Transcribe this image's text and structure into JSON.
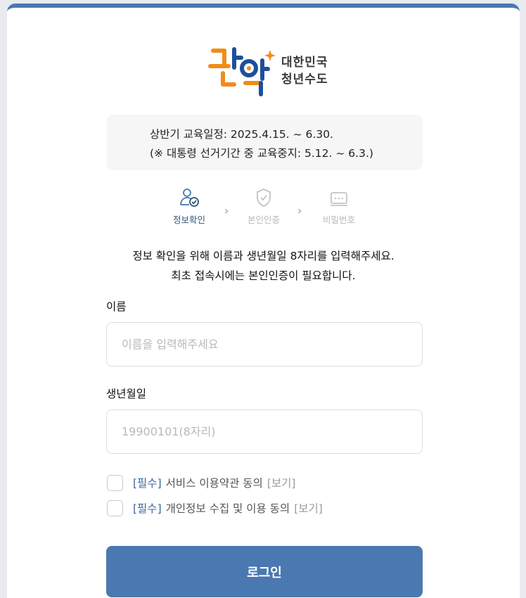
{
  "logo": {
    "tagline_line1": "대한민국",
    "tagline_line2": "청년수도"
  },
  "notice": {
    "line1": "상반기 교육일정: 2025.4.15. ~ 6.30.",
    "line2": "(※ 대통령 선거기간 중 교육중지: 5.12. ~ 6.3.)"
  },
  "steps": [
    {
      "label": "정보확인",
      "icon": "user-check-icon",
      "state": "active"
    },
    {
      "label": "본인인증",
      "icon": "shield-check-icon",
      "state": "inactive"
    },
    {
      "label": "비밀번호",
      "icon": "password-icon",
      "state": "inactive"
    }
  ],
  "instruction": {
    "line1": "정보 확인을 위해 이름과 생년월일 8자리를 입력해주세요.",
    "line2": "최초 접속시에는 본인인증이 필요합니다."
  },
  "form": {
    "name_label": "이름",
    "name_placeholder": "이름을 입력해주세요",
    "birth_label": "생년월일",
    "birth_placeholder": "19900101(8자리)"
  },
  "agreements": [
    {
      "required": "[필수]",
      "text": "서비스 이용약관 동의",
      "view": "[보기]",
      "checked": false
    },
    {
      "required": "[필수]",
      "text": "개인정보 수집 및 이용 동의",
      "view": "[보기]",
      "checked": false
    }
  ],
  "login_button": "로그인",
  "colors": {
    "primary": "#4a78b0",
    "logo_orange": "#f08c1a",
    "logo_blue": "#1d4f9c",
    "required_blue": "#3c64a2"
  }
}
